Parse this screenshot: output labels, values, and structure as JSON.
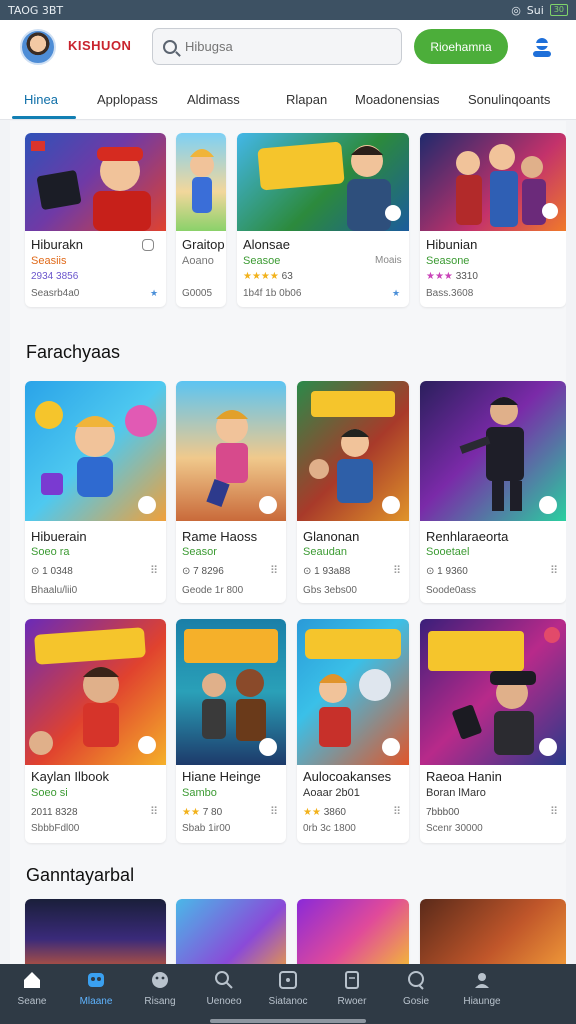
{
  "status_bar": {
    "time": "TAOG 3BT",
    "signal_text": "Sui",
    "battery": "30"
  },
  "header": {
    "brand": "KISHUON",
    "search_placeholder": "Hibugsa",
    "cta_label": "Rioehamna"
  },
  "tabs": [
    {
      "label": "Hinea",
      "active": true
    },
    {
      "label": "Applopass"
    },
    {
      "label": "Aldimass"
    },
    {
      "label": "Rlapan"
    },
    {
      "label": "Moadonensias"
    },
    {
      "label": "Sonulinqoants"
    }
  ],
  "featured": [
    {
      "title": "Hiburakn",
      "subtitle": "Seasiis",
      "rating": "2934 3856",
      "meta": "Seasrb4a0"
    },
    {
      "title": "Graitop",
      "subtitle": "Aoano",
      "rating": "",
      "meta": "G0005"
    },
    {
      "title": "Alonsae",
      "subtitle": "Seasoe",
      "rating": "63",
      "rating_prefix": "★★★★",
      "meta": "1b4f 1b 0b06",
      "side": "Moais"
    },
    {
      "title": "Hibunian",
      "subtitle": "Seasone",
      "rating": "3310",
      "rating_prefix": "★★★",
      "meta": "Bass.3608"
    }
  ],
  "section_1": {
    "title": "Farachyaas"
  },
  "grid_1": [
    {
      "title": "Hibuerain",
      "subtitle": "Soeo ra",
      "rating": "1 0348",
      "meta": "Bhaalu/lii0"
    },
    {
      "title": "Rame Haoss",
      "subtitle": "Seasor",
      "rating": "7 8296",
      "meta": "Geode 1r 800"
    },
    {
      "title": "Glanonan",
      "subtitle": "Seaudan",
      "rating": "1 93a88",
      "meta": "Gbs 3ebs00"
    },
    {
      "title": "Renhlaraeorta",
      "subtitle": "Sooetael",
      "rating": "1 9360",
      "meta": "Soode0ass"
    }
  ],
  "grid_2": [
    {
      "title": "Kaylan Ilbook",
      "subtitle": "Soeo si",
      "rating": "2011 8328",
      "meta": "SbbbFdl00"
    },
    {
      "title": "Hiane Heinge",
      "subtitle": "Sambo",
      "rating": "7 80",
      "rating_prefix": "★★",
      "meta": "Sbab 1ir00"
    },
    {
      "title": "Aulocoakanses",
      "subtitle": "Aoaar 2b01",
      "rating": "3860",
      "rating_prefix": "★★",
      "meta": "0rb 3c 1800"
    },
    {
      "title": "Raeoa Hanin",
      "subtitle": "Boran lMaro",
      "rating": "7bbb00",
      "meta": "Scenr 30000"
    }
  ],
  "section_2": {
    "title": "Ganntayarbal"
  },
  "bottom_nav": [
    {
      "label": "Seane",
      "icon": "home-icon"
    },
    {
      "label": "Mlaane",
      "icon": "game-controller-icon",
      "active": true
    },
    {
      "label": "Risang",
      "icon": "smiley-icon"
    },
    {
      "label": "Uenoeo",
      "icon": "search-icon"
    },
    {
      "label": "Siatanoc",
      "icon": "square-icon"
    },
    {
      "label": "Rwoer",
      "icon": "document-icon"
    },
    {
      "label": "Gosie",
      "icon": "chat-icon"
    },
    {
      "label": "Hiaunge",
      "icon": "person-icon"
    }
  ]
}
